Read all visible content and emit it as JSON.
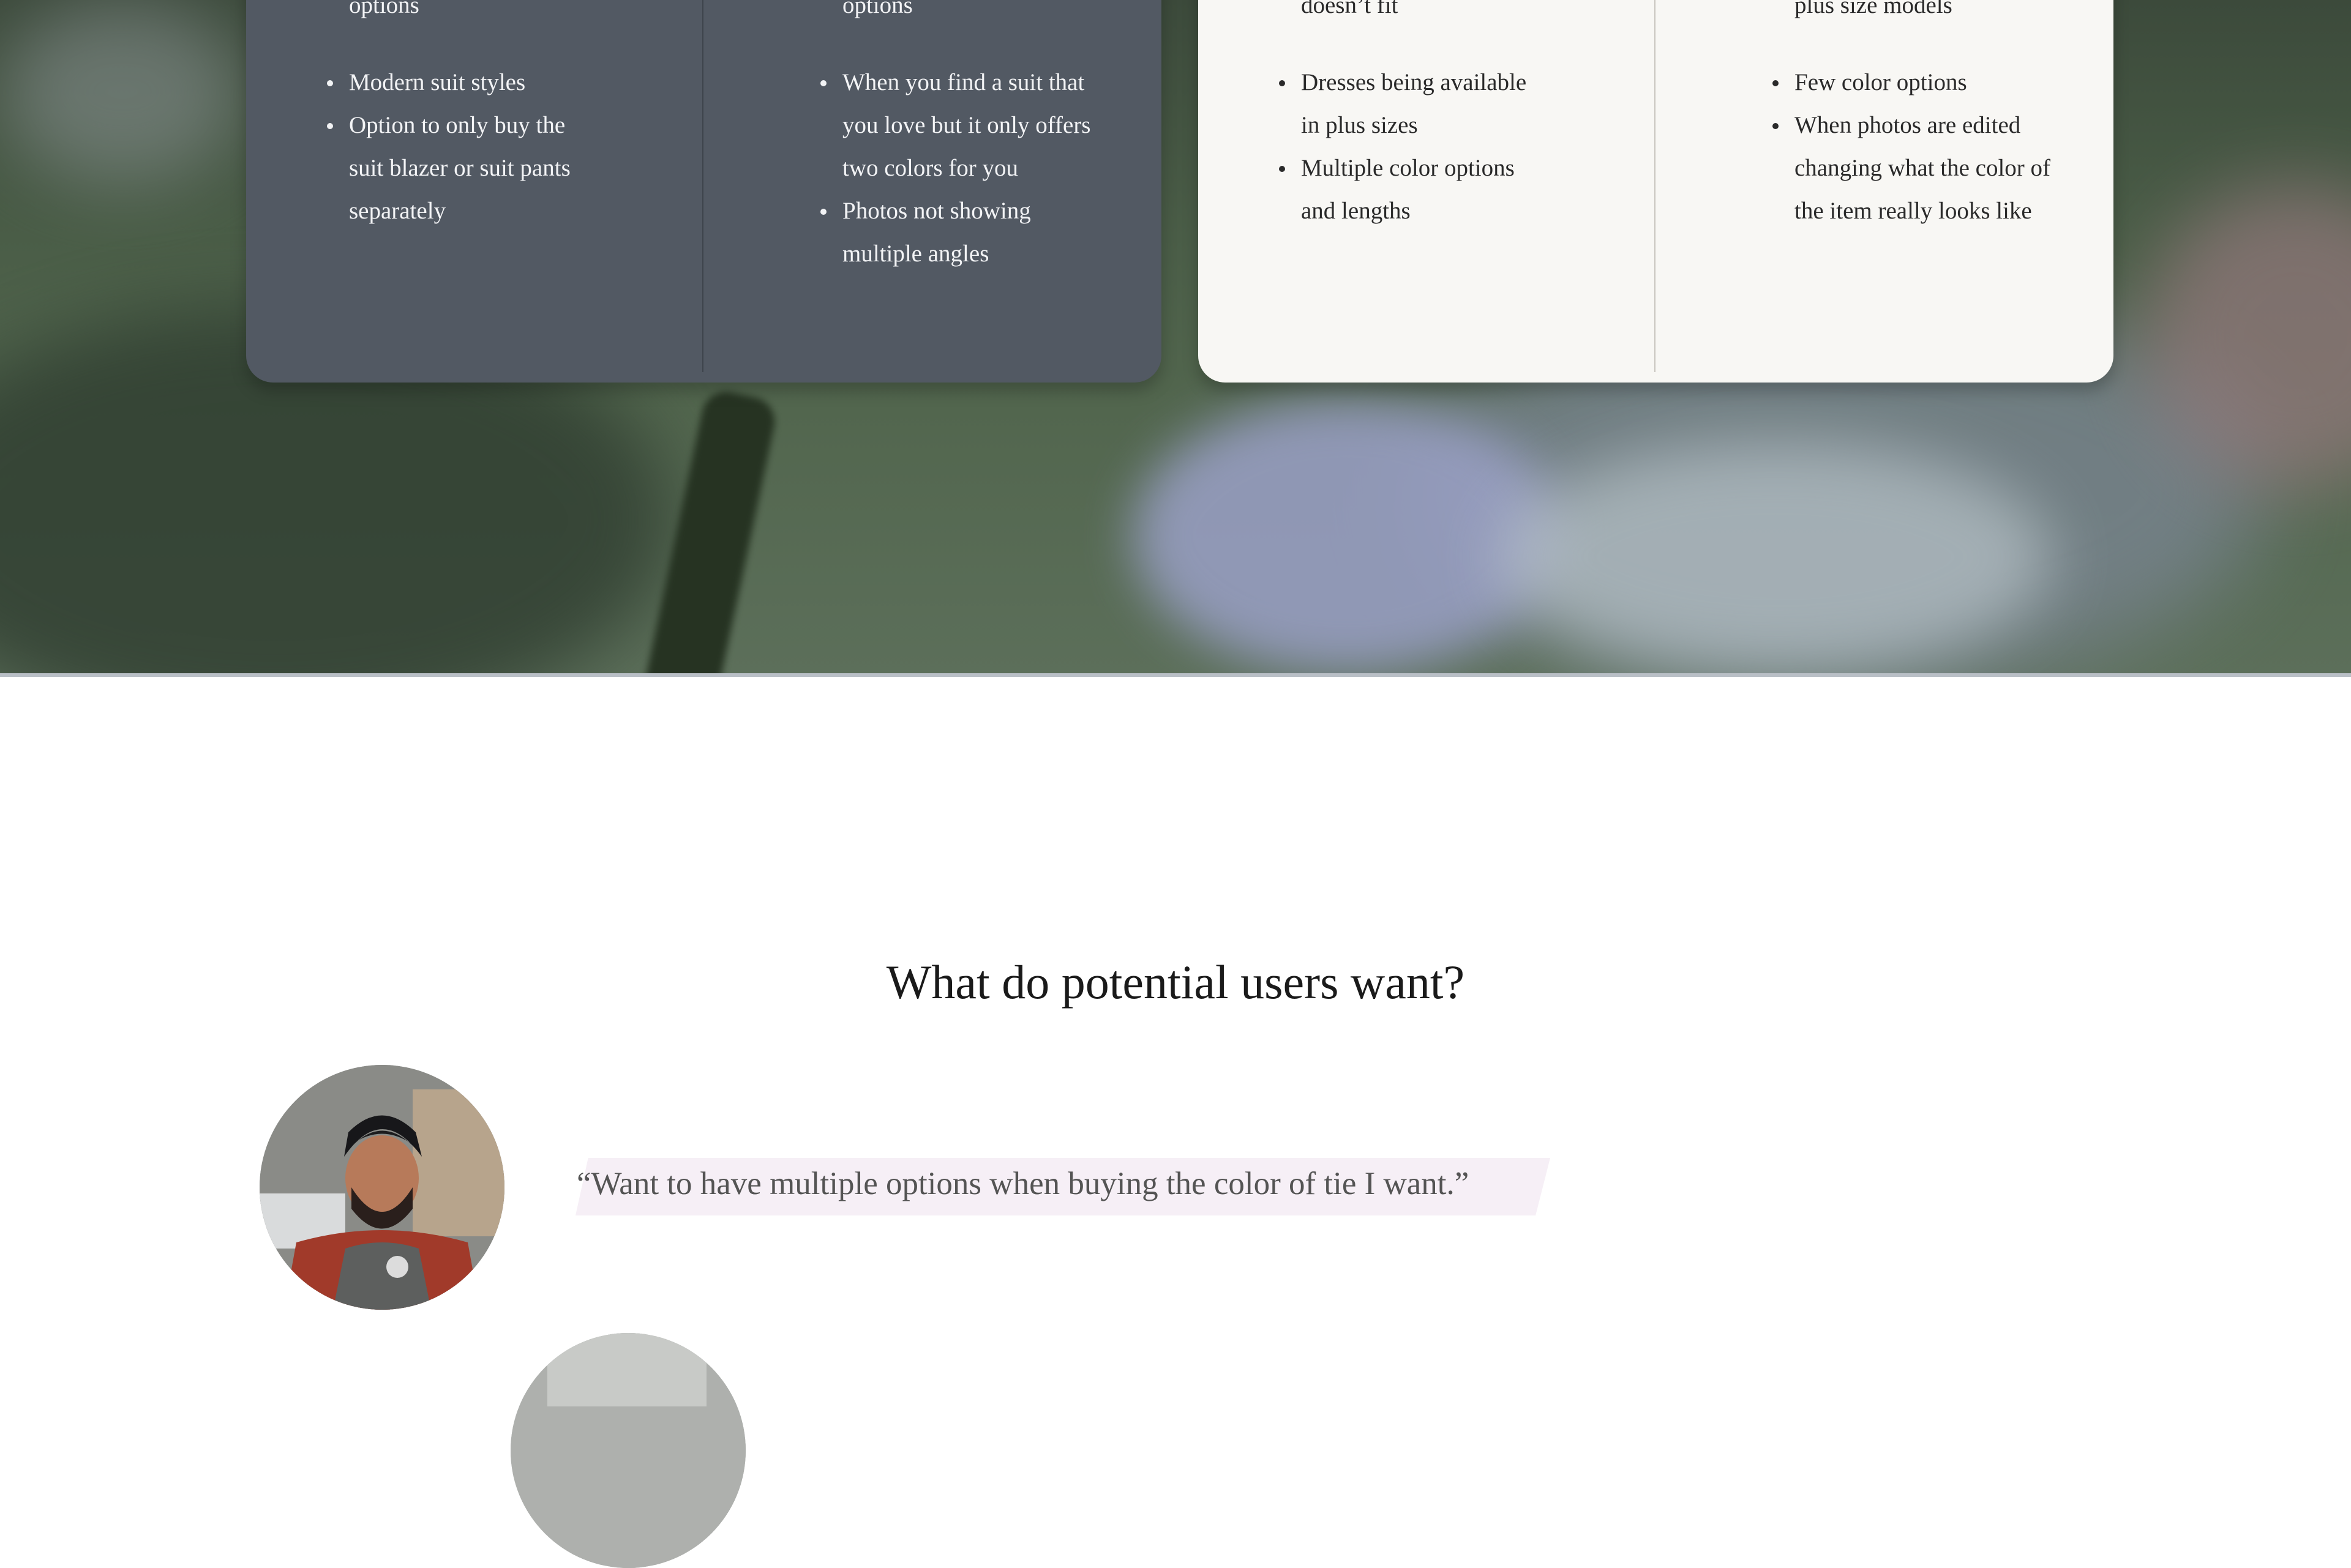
{
  "cards": {
    "dark": {
      "left_items": [
        "Multiple suit color options",
        "Modern suit styles",
        "Option to only buy the suit blazer or suit pants separately"
      ],
      "right_items": [
        "Suits not available in long options",
        "When you find a suit that you love but it only offers two colors for you",
        "Photos not showing multiple angles"
      ]
    },
    "light": {
      "left_items": [
        "Free returns for what doesn’t fit",
        "Dresses being available in plus sizes",
        "Multiple color options and lengths"
      ],
      "right_items": [
        "Does offer not including plus size models",
        "Few color options",
        "When photos are edited changing what the color of the item really looks like"
      ]
    }
  },
  "section": {
    "title": "What do potential users want?",
    "quotes": [
      {
        "text": "“Want to have multiple options when buying the color of tie I want.”"
      }
    ]
  },
  "colors": {
    "dark_card": "#525963",
    "light_card": "#f8f7f4",
    "quote_highlight": "#f6eff6"
  }
}
